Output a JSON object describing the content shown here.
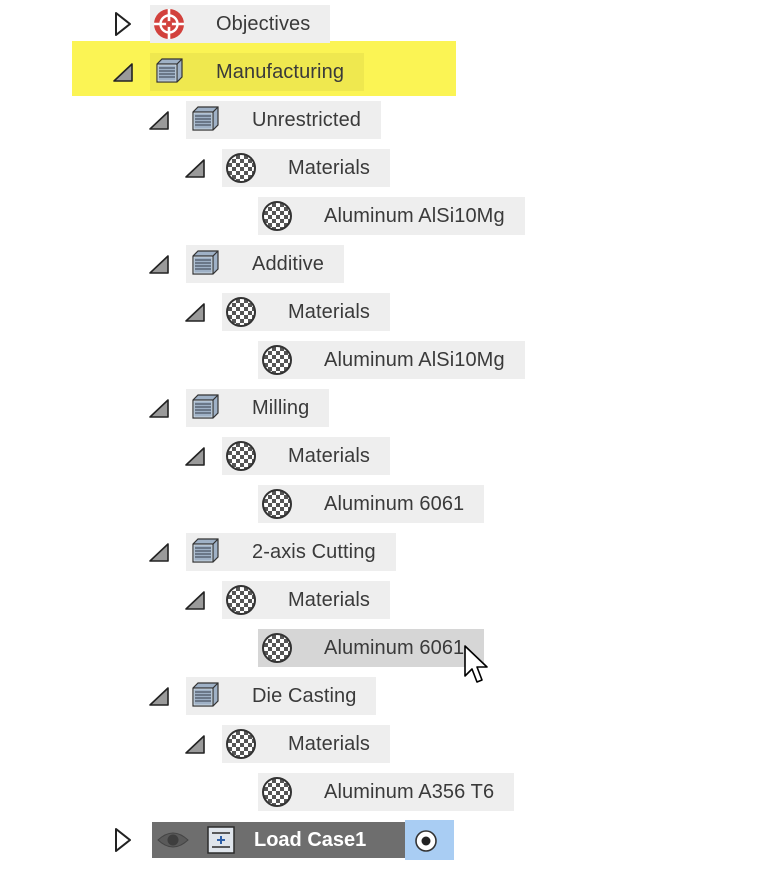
{
  "tree": {
    "objectives": {
      "label": "Objectives",
      "icon": "target-icon",
      "expanded": false
    },
    "manufacturing": {
      "label": "Manufacturing",
      "icon": "manufacturing-stack-icon",
      "expanded": true,
      "selected": true,
      "highlight_color": "#fbf454",
      "children": [
        {
          "label": "Unrestricted",
          "icon": "manufacturing-stack-icon",
          "materials": {
            "label": "Materials",
            "icon": "material-checker-icon",
            "items": [
              "Aluminum AlSi10Mg"
            ]
          }
        },
        {
          "label": "Additive",
          "icon": "manufacturing-stack-icon",
          "materials": {
            "label": "Materials",
            "icon": "material-checker-icon",
            "items": [
              "Aluminum AlSi10Mg"
            ]
          }
        },
        {
          "label": "Milling",
          "icon": "manufacturing-stack-icon",
          "materials": {
            "label": "Materials",
            "icon": "material-checker-icon",
            "items": [
              "Aluminum 6061"
            ]
          }
        },
        {
          "label": "2-axis Cutting",
          "icon": "manufacturing-stack-icon",
          "materials": {
            "label": "Materials",
            "icon": "material-checker-icon",
            "items": [
              "Aluminum 6061"
            ]
          }
        },
        {
          "label": "Die Casting",
          "icon": "manufacturing-stack-icon",
          "materials": {
            "label": "Materials",
            "icon": "material-checker-icon",
            "items": [
              "Aluminum A356 T6"
            ]
          }
        }
      ]
    },
    "load_case": {
      "label": "Load Case1",
      "icon_visibility": "eye-icon",
      "icon_type": "load-case-icon",
      "active_radio": "radio-selected-icon",
      "background": "#6e6e6e",
      "radio_background": "#a9cdf3",
      "expanded": false
    }
  },
  "hovered_item": "Aluminum 6061 (2-axis Cutting)"
}
